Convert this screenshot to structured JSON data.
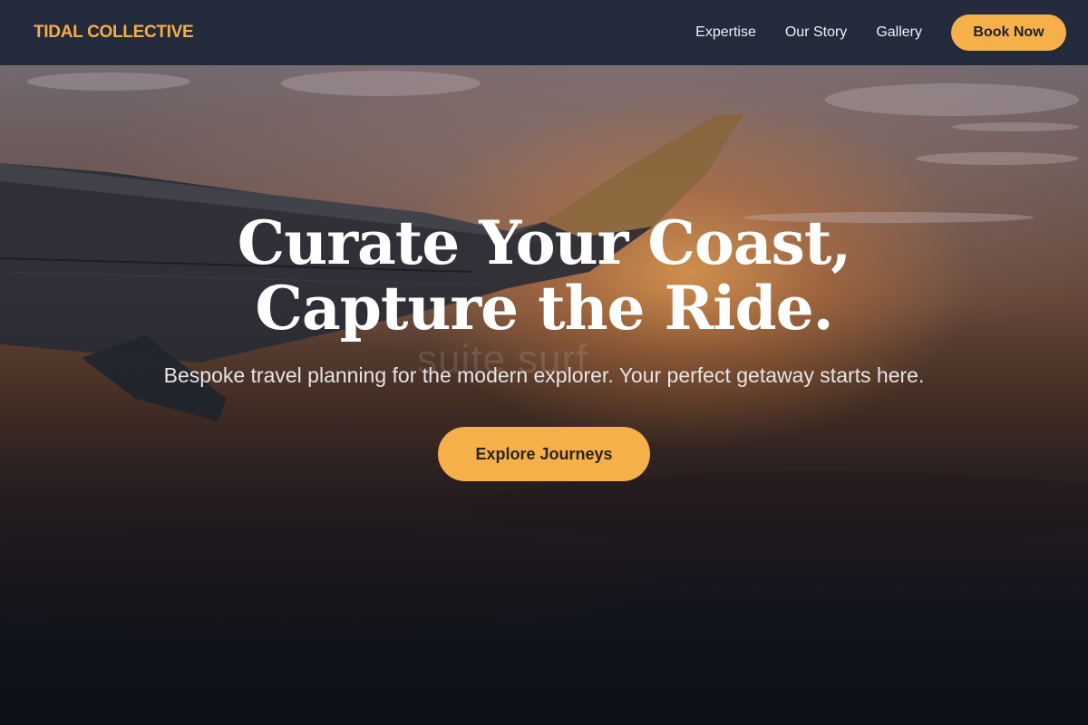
{
  "brand": {
    "name": "TIDAL COLLECTIVE"
  },
  "nav": {
    "links": [
      {
        "label": "Expertise"
      },
      {
        "label": "Our Story"
      },
      {
        "label": "Gallery"
      }
    ],
    "cta_label": "Book Now"
  },
  "hero": {
    "headline_line1": "Curate Your Coast,",
    "headline_line2": "Capture the Ride.",
    "subtitle": "Bespoke travel planning for the modern explorer. Your perfect getaway starts here.",
    "cta_label": "Explore Journeys",
    "watermark": "suite surf"
  },
  "colors": {
    "accent": "#f6b04a",
    "brand_text": "#f6ad45",
    "nav_background": "#1e2638"
  }
}
